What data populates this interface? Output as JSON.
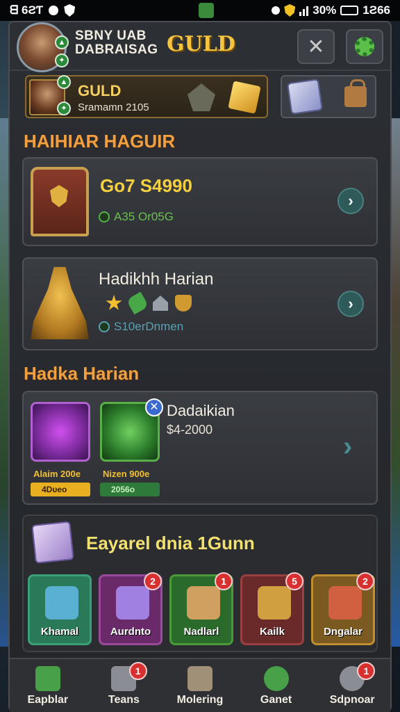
{
  "status_bar": {
    "left_text": "ᗺ 6ƧƬ",
    "battery": "30%",
    "time": "1Ƨ66"
  },
  "header": {
    "player_name_line1": "SBNY UAB",
    "player_name_line2": "DABRAISAG",
    "title": "GULD",
    "close_icon": "✕"
  },
  "guild_bar": {
    "name": "GULD",
    "subtitle": "Sramamn 2105"
  },
  "section1": {
    "title": "HAIHIAR HAGUIR"
  },
  "card1": {
    "title": "Go7 S4990",
    "subtitle": "A35 Or05G"
  },
  "card2": {
    "title": "Hadikhh Harian",
    "subtitle": "S10erDnmen"
  },
  "section2": {
    "title": "Hadka Harian"
  },
  "card3": {
    "title": "Dadaikian",
    "value": "$4-2000",
    "item1": {
      "label": "Alaim 200e",
      "bar": "4Dᴜeo"
    },
    "item2": {
      "label": "Nizen 900e",
      "bar": "2056o"
    },
    "plus": "✕"
  },
  "event": {
    "title": "Eayarel dnia 1Gunn",
    "tiles": [
      {
        "label": "Khamal",
        "badge": "",
        "color": "#2a7a5a",
        "border": "#3aa07a",
        "art": "#5ab0d0"
      },
      {
        "label": "Aurdnto",
        "badge": "2",
        "color": "#6a2a6a",
        "border": "#9a4a9a",
        "art": "#a080e0"
      },
      {
        "label": "Nadlarl",
        "badge": "1",
        "color": "#2a6a2a",
        "border": "#4a9a3a",
        "art": "#d0a060"
      },
      {
        "label": "Kailk",
        "badge": "5",
        "color": "#6a2a2a",
        "border": "#9a4040",
        "art": "#d0a040"
      },
      {
        "label": "Dngalar",
        "badge": "2",
        "color": "#7a5a20",
        "border": "#c09030",
        "art": "#d06040"
      }
    ]
  },
  "bottom_nav": [
    {
      "label": "Eapblar",
      "badge": "",
      "icon_color": "#48a048"
    },
    {
      "label": "Teans",
      "badge": "1",
      "icon_color": "#8a8e94"
    },
    {
      "label": "Molering",
      "badge": "",
      "icon_color": "#a09078"
    },
    {
      "label": "Ganet",
      "badge": "",
      "icon_color": "#48a048"
    },
    {
      "label": "Sdpnoar",
      "badge": "1",
      "icon_color": "#8a8e94"
    }
  ]
}
